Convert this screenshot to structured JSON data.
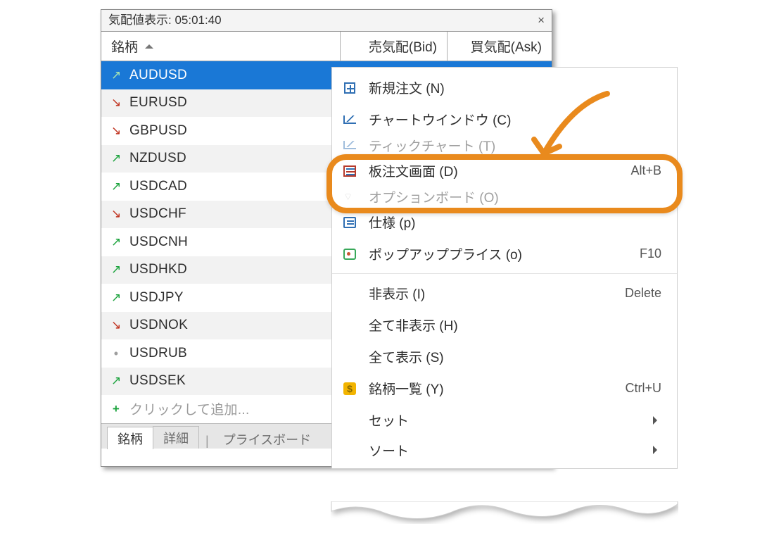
{
  "window": {
    "title": "気配値表示: 05:01:40",
    "cols": {
      "symbol": "銘柄",
      "bid": "売気配(Bid)",
      "ask": "買気配(Ask)"
    },
    "rows": [
      {
        "dir": "up",
        "sym": "AUDUSD",
        "sel": true
      },
      {
        "dir": "dn",
        "sym": "EURUSD"
      },
      {
        "dir": "dn",
        "sym": "GBPUSD"
      },
      {
        "dir": "up",
        "sym": "NZDUSD"
      },
      {
        "dir": "up",
        "sym": "USDCAD"
      },
      {
        "dir": "dn",
        "sym": "USDCHF"
      },
      {
        "dir": "up",
        "sym": "USDCNH"
      },
      {
        "dir": "up",
        "sym": "USDHKD"
      },
      {
        "dir": "up",
        "sym": "USDJPY"
      },
      {
        "dir": "dn",
        "sym": "USDNOK"
      },
      {
        "dir": "dot",
        "sym": "USDRUB"
      },
      {
        "dir": "up",
        "sym": "USDSEK"
      }
    ],
    "add_hint": "クリックして追加...",
    "tabs": {
      "a": "銘柄",
      "b": "詳細",
      "c": "プライスボード"
    }
  },
  "menu": {
    "items": [
      {
        "icon": "box",
        "label": "新規注文 (N)"
      },
      {
        "icon": "line",
        "label": "チャートウインドウ (C)"
      },
      {
        "icon": "line",
        "label": "ティックチャート (T)",
        "muted": true
      },
      {
        "icon": "depth",
        "label": "板注文画面 (D)",
        "shortcut": "Alt+B"
      },
      {
        "icon": "strike",
        "label": "オプションボード (O)",
        "muted": true
      },
      {
        "icon": "spec",
        "label": "仕様 (p)"
      },
      {
        "icon": "pop",
        "label": "ポップアッププライス (o)",
        "shortcut": "F10"
      },
      {
        "sep": true
      },
      {
        "label": "非表示 (I)",
        "shortcut": "Delete"
      },
      {
        "label": "全て非表示 (H)"
      },
      {
        "label": "全て表示 (S)"
      },
      {
        "icon": "doll",
        "label": "銘柄一覧 (Y)",
        "shortcut": "Ctrl+U"
      },
      {
        "label": "セット",
        "submenu": true
      },
      {
        "label": "ソート",
        "submenu": true
      }
    ]
  }
}
